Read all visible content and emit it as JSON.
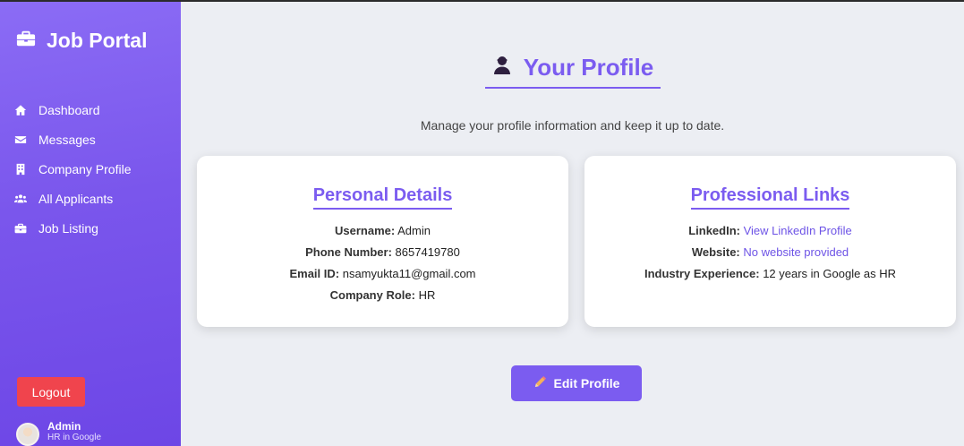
{
  "app": {
    "title": "Job Portal",
    "icon": "briefcase-icon"
  },
  "sidebar": {
    "items": [
      {
        "label": "Dashboard",
        "icon": "home-icon"
      },
      {
        "label": "Messages",
        "icon": "envelope-icon"
      },
      {
        "label": "Company Profile",
        "icon": "building-icon"
      },
      {
        "label": "All Applicants",
        "icon": "users-icon"
      },
      {
        "label": "Job Listing",
        "icon": "briefcase-icon"
      }
    ],
    "logout_label": "Logout",
    "user": {
      "name": "Admin",
      "role": "HR in Google"
    }
  },
  "main": {
    "title": "Your Profile",
    "title_icon": "user-icon",
    "subtitle": "Manage your profile information and keep it up to date.",
    "personal": {
      "title": "Personal Details",
      "username_label": "Username:",
      "username": "Admin",
      "phone_label": "Phone Number:",
      "phone": "8657419780",
      "email_label": "Email ID:",
      "email": "nsamyukta11@gmail.com",
      "role_label": "Company Role:",
      "role": "HR"
    },
    "professional": {
      "title": "Professional Links",
      "linkedin_label": "LinkedIn:",
      "linkedin": "View LinkedIn Profile",
      "website_label": "Website:",
      "website": "No website provided",
      "experience_label": "Industry Experience:",
      "experience": "12 years in Google as HR"
    },
    "edit_label": "Edit Profile",
    "edit_icon": "pencil-icon"
  },
  "colors": {
    "accent": "#7b5cf0",
    "sidebar": "#7a56ec",
    "logout": "#f0444d",
    "link": "#6d53e6"
  }
}
